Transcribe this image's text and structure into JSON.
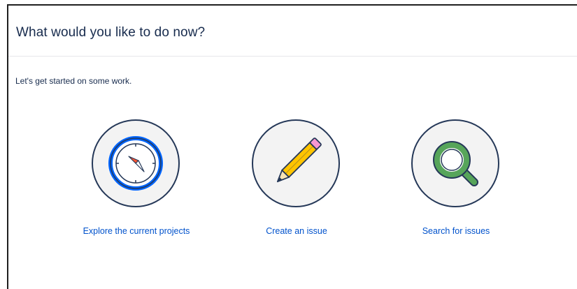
{
  "page": {
    "title": "What would you like to do now?",
    "intro": "Let's get started on some work."
  },
  "actions": [
    {
      "label": "Explore the current projects",
      "icon": "compass-icon"
    },
    {
      "label": "Create an issue",
      "icon": "pencil-icon"
    },
    {
      "label": "Search for issues",
      "icon": "magnifier-icon"
    }
  ],
  "colors": {
    "title_text": "#172b4d",
    "link": "#0052cc",
    "circle_border": "#253858",
    "circle_fill": "#f3f3f3",
    "compass_ring": "#0065ff",
    "pencil_body": "#ffc400",
    "pencil_eraser": "#f797d2",
    "magnifier": "#57a55a"
  }
}
